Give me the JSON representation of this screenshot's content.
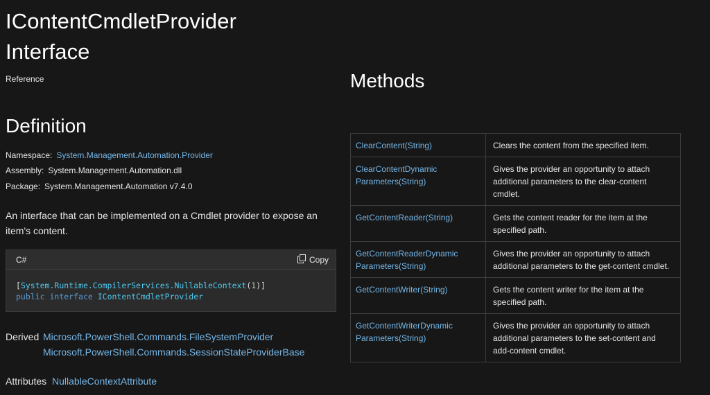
{
  "page": {
    "title_line1": "IContentCmdletProvider",
    "title_line2": "Interface",
    "reference": "Reference"
  },
  "definition": {
    "heading": "Definition",
    "namespace_label": "Namespace:",
    "namespace_value": "System.Management.Automation.Provider",
    "assembly_label": "Assembly:",
    "assembly_value": "System.Management.Automation.dll",
    "package_label": "Package:",
    "package_value": "System.Management.Automation v7.4.0",
    "summary": "An interface that can be implemented on a Cmdlet provider to expose an item's content."
  },
  "code": {
    "language": "C#",
    "copy_label": "Copy",
    "line1_open": "[",
    "line1_type": "System.Runtime.CompilerServices.NullableContext",
    "line1_paren_open": "(",
    "line1_num": "1",
    "line1_close": ")]",
    "line2_kw1": "public",
    "line2_kw2": "interface",
    "line2_name": "IContentCmdletProvider"
  },
  "derived": {
    "label": "Derived",
    "items": [
      "Microsoft.PowerShell.Commands.FileSystemProvider",
      "Microsoft.PowerShell.Commands.SessionStateProviderBase"
    ]
  },
  "attributes": {
    "label": "Attributes",
    "value": "NullableContextAttribute"
  },
  "methods": {
    "heading": "Methods",
    "rows": [
      {
        "name": "ClearContent(String)",
        "desc": "Clears the content from the specified item."
      },
      {
        "name": "ClearContentDynamic Parameters(String)",
        "desc": "Gives the provider an opportunity to attach additional parameters to the clear-content cmdlet."
      },
      {
        "name": "GetContentReader(String)",
        "desc": "Gets the content reader for the item at the specified path."
      },
      {
        "name": "GetContentReaderDynamic Parameters(String)",
        "desc": "Gives the provider an opportunity to attach additional parameters to the get-content cmdlet."
      },
      {
        "name": "GetContentWriter(String)",
        "desc": "Gets the content writer for the item at the specified path."
      },
      {
        "name": "GetContentWriterDynamic Parameters(String)",
        "desc": "Gives the provider an opportunity to attach additional parameters to the set-content and add-content cmdlet."
      }
    ]
  },
  "icons": {
    "copy": "copy-icon"
  }
}
